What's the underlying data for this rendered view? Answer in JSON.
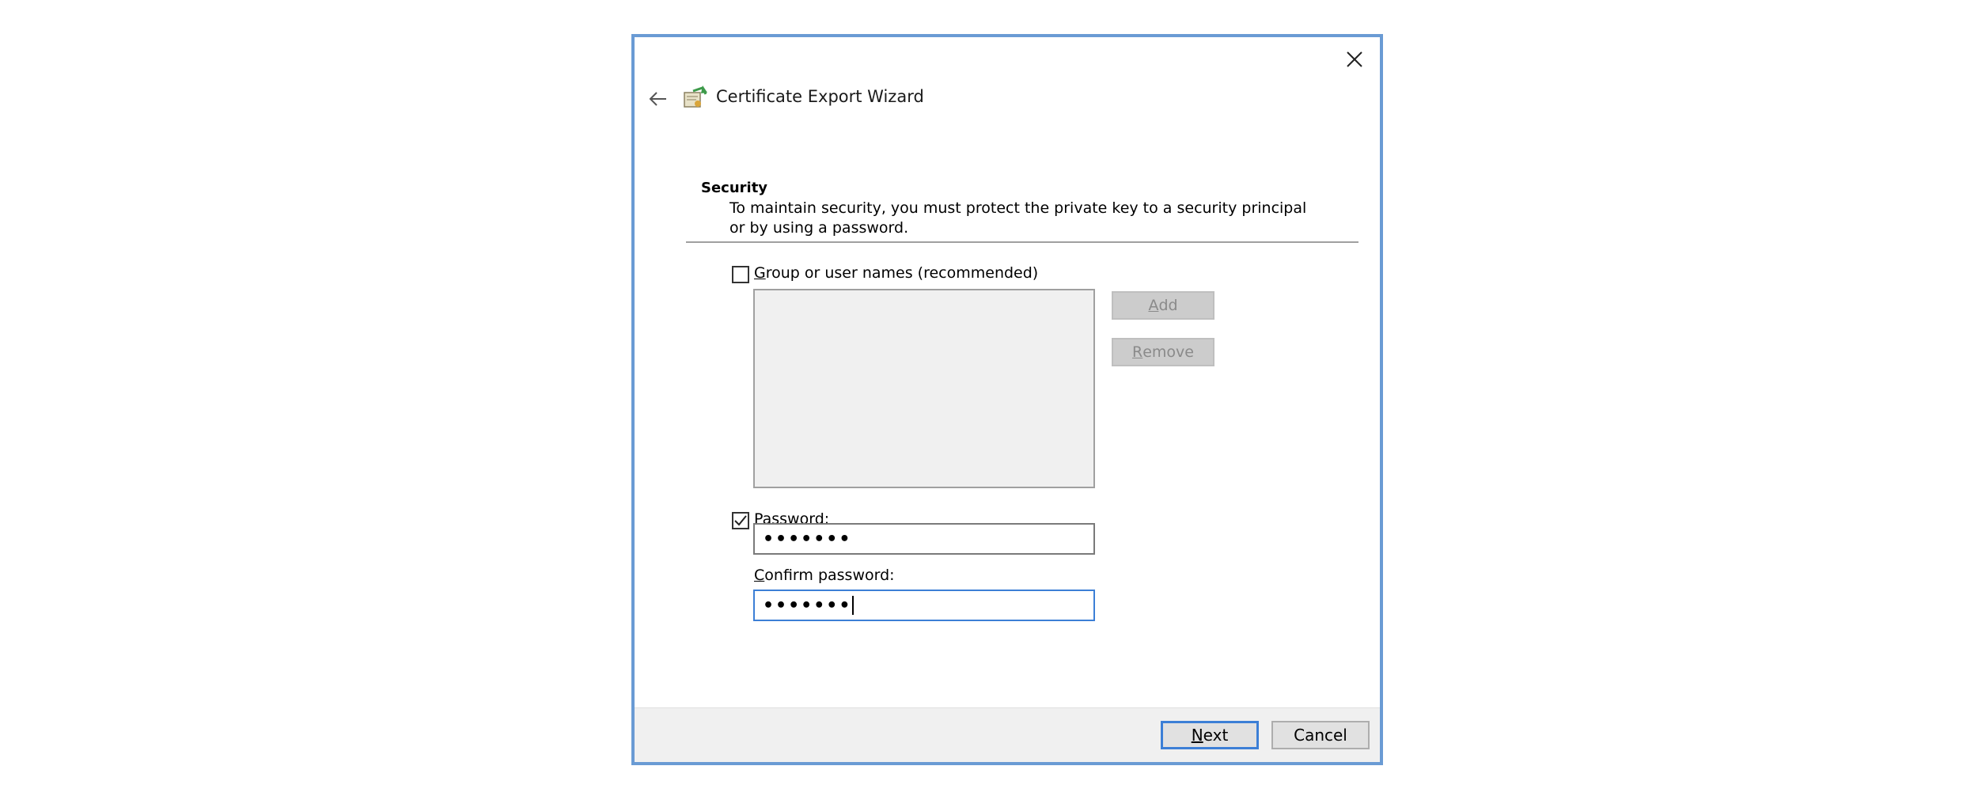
{
  "wizard": {
    "title": "Certificate Export Wizard",
    "back_icon": "back-arrow-icon",
    "close_icon": "close-icon",
    "app_icon": "certificate-icon"
  },
  "security": {
    "heading": "Security",
    "description": "To maintain security, you must protect the private key to a security principal or by using a password."
  },
  "group": {
    "checked": false,
    "label_accel": "G",
    "label_rest": "roup or user names (recommended)",
    "add_accel": "A",
    "add_rest": "dd",
    "remove_accel": "R",
    "remove_rest": "emove"
  },
  "password": {
    "checked": true,
    "label_accel": "P",
    "label_rest": "assword:",
    "value": "•••••••"
  },
  "confirm": {
    "label_accel": "C",
    "label_rest": "onfirm password:",
    "value": "•••••••"
  },
  "footer": {
    "next_accel": "N",
    "next_rest": "ext",
    "cancel_label": "Cancel"
  },
  "colors": {
    "dialog_border": "#6a9bd4",
    "focus": "#3c7fd6"
  }
}
